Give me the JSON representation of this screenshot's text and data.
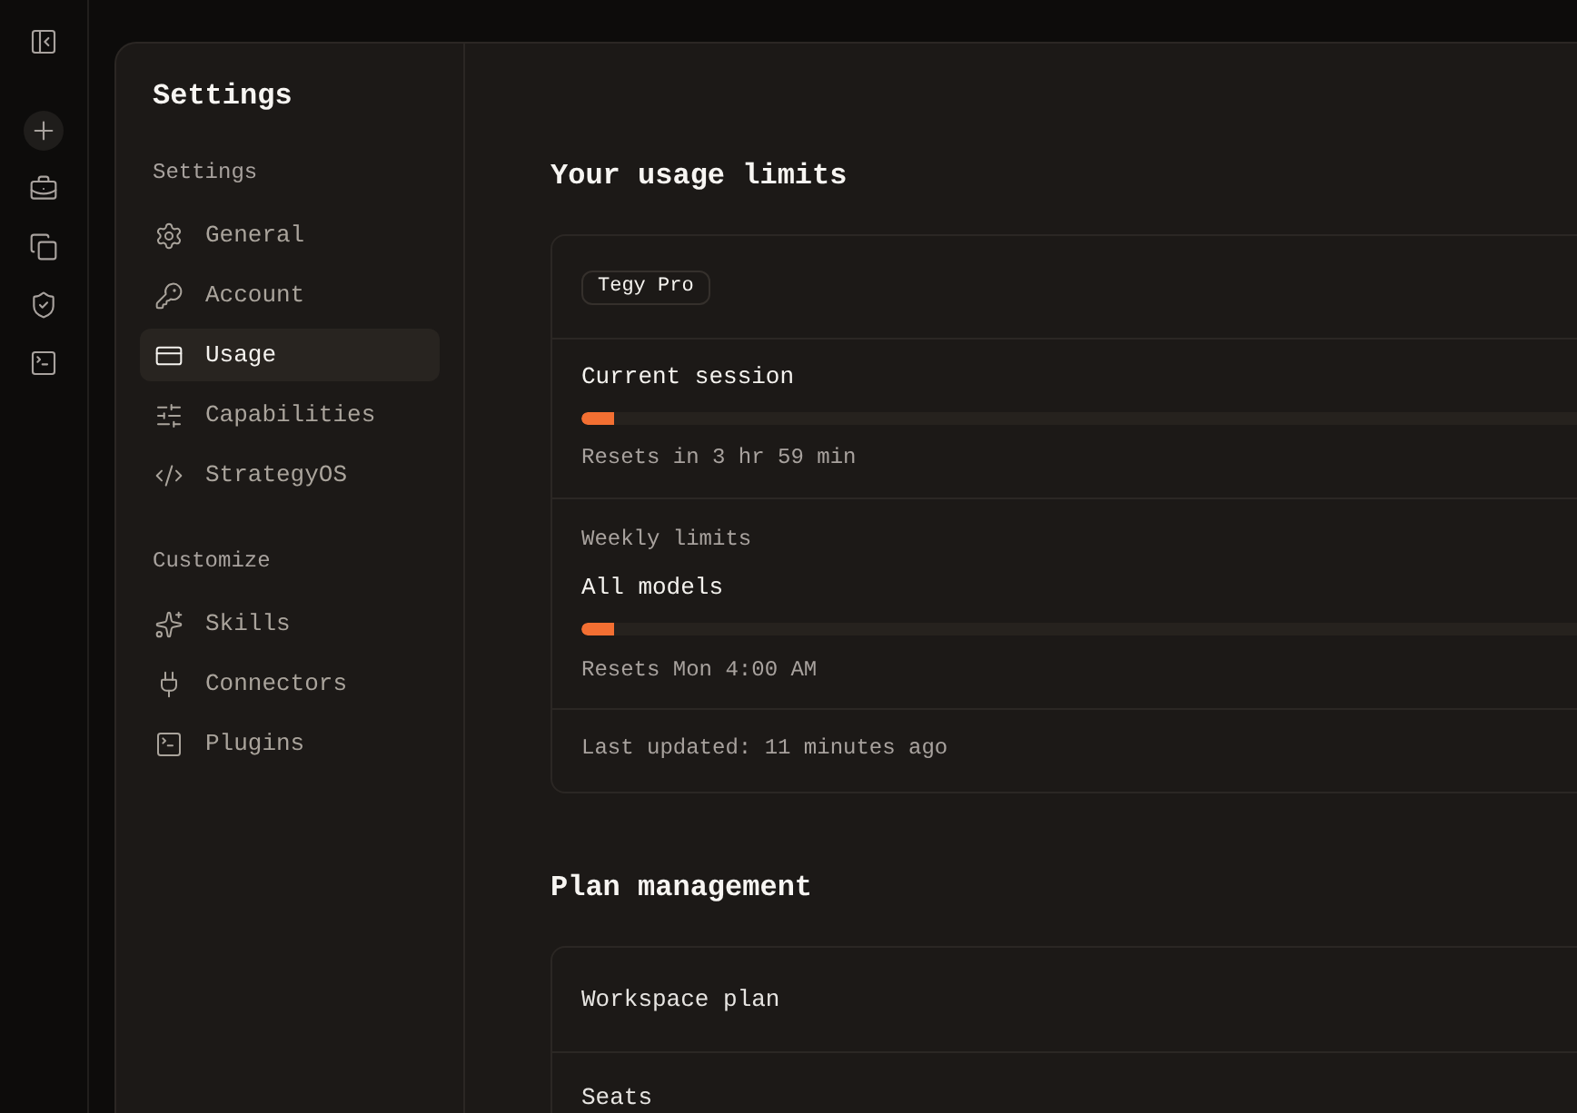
{
  "settings": {
    "title": "Settings",
    "groups": [
      {
        "label": "Settings",
        "items": [
          {
            "label": "General",
            "selected": false
          },
          {
            "label": "Account",
            "selected": false
          },
          {
            "label": "Usage",
            "selected": true
          },
          {
            "label": "Capabilities",
            "selected": false
          },
          {
            "label": "StrategyOS",
            "selected": false
          }
        ]
      },
      {
        "label": "Customize",
        "items": [
          {
            "label": "Skills",
            "selected": false
          },
          {
            "label": "Connectors",
            "selected": false
          },
          {
            "label": "Plugins",
            "selected": false
          }
        ]
      }
    ]
  },
  "usage": {
    "heading": "Your usage limits",
    "plan_badge": "Tegy Pro",
    "session": {
      "label": "Current session",
      "level": 0.03,
      "reading": "Resets in 3 hr 59 min"
    },
    "weekly": {
      "section_label": "Weekly limits",
      "label": "All models",
      "level": 0.03,
      "reading": "Resets Mon 4:00 AM"
    },
    "last_updated": "Last updated: 11 minutes ago"
  },
  "plan": {
    "heading": "Plan management",
    "rows": [
      "Workspace plan",
      "Seats"
    ]
  }
}
